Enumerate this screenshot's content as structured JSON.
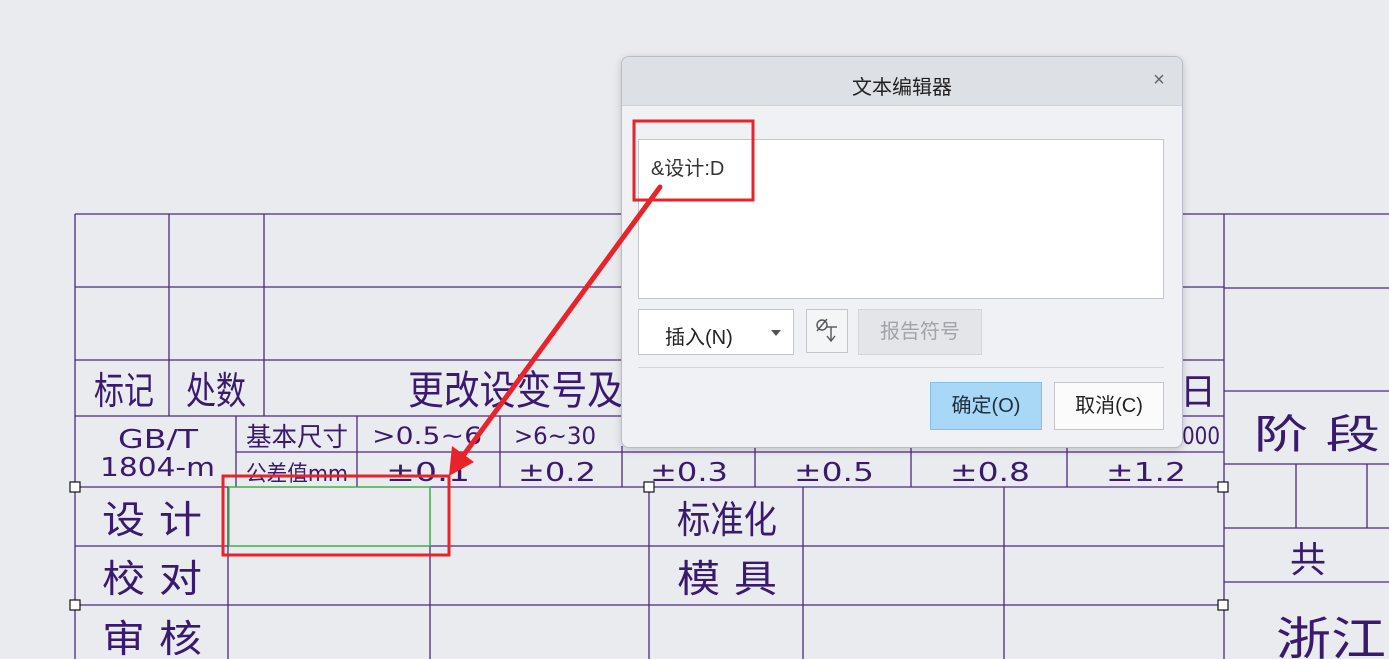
{
  "dialog": {
    "title": "文本编辑器",
    "close_label": "×",
    "editor_text": "&设计:D",
    "insert_label": "插入(N)",
    "symbol_icon": "dimension-symbol-icon",
    "report_symbol_label": "报告符号",
    "ok_label": "确定(O)",
    "cancel_label": "取消(C)"
  },
  "drawing": {
    "header_row": {
      "mark": "标记",
      "count": "处数",
      "change": "更改设变号及",
      "date_tail": "日"
    },
    "tolerance": {
      "standard_line1": "GB/T",
      "standard_line2": "1804-m",
      "basic_size_label": "基本尺寸",
      "tolerance_label": "公差值mm",
      "ranges": [
        ">0.5~6",
        ">6~30",
        "000"
      ],
      "values": [
        "±0.1",
        "±0.2",
        "±0.3",
        "±0.5",
        "±0.8",
        "±1.2"
      ]
    },
    "sign_rows": {
      "design": "设 计",
      "check": "校 对",
      "review": "审 核"
    },
    "mid_labels": {
      "standardize": "标准化",
      "mold": "模 具"
    },
    "right_block": {
      "stage": "阶 段",
      "total": "共",
      "company_partial": "浙江"
    }
  },
  "annotation": {
    "highlight_color": "#e8242a",
    "selection_color": "#39c23d"
  }
}
